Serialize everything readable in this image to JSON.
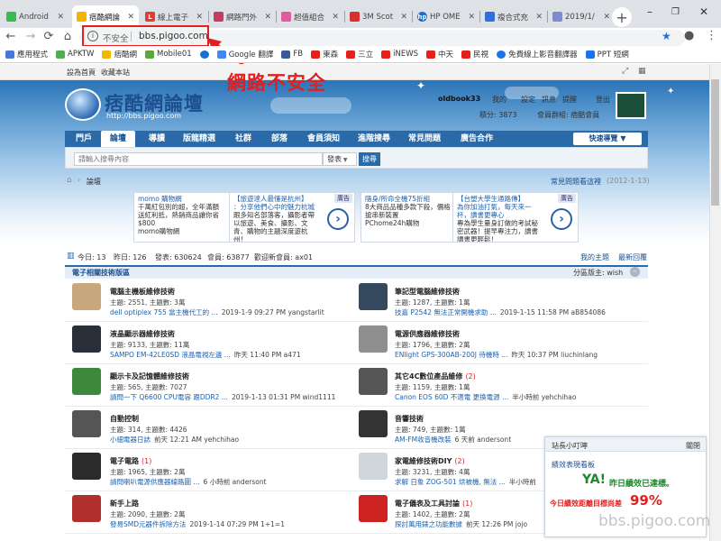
{
  "browser": {
    "tabs": [
      {
        "label": "Android",
        "fav_color": "#3dba4e"
      },
      {
        "label": "痞酷網論",
        "fav_color": "#f2b600"
      },
      {
        "label": "線上電子",
        "fav_color": "#e23d2d"
      },
      {
        "label": "網路門外",
        "fav_color": "#c53c63"
      },
      {
        "label": "超值組合",
        "fav_color": "#e05aa0"
      },
      {
        "label": "3M Scot",
        "fav_color": "#d83030"
      },
      {
        "label": "HP OME",
        "fav_color": "#1a6fd1"
      },
      {
        "label": "複合式充",
        "fav_color": "#2f6fd8"
      },
      {
        "label": "2019/1/",
        "fav_color": "#7d8bd6"
      }
    ],
    "new_tab_symbol": "+",
    "window_controls": [
      "–",
      "❐",
      "✕"
    ],
    "nav": {
      "back": "←",
      "forward": "→",
      "reload": "⟳",
      "home": "⌂"
    },
    "security_label": "不安全",
    "url": "bbs.pigoo.com",
    "info_symbol": "i",
    "star_symbol": "★",
    "account_symbol": "●",
    "menu_symbol": "⋮",
    "bookmarks": [
      {
        "label": "應用程式",
        "color": "#4a76d8"
      },
      {
        "label": "APKTW",
        "color": "#4caf50"
      },
      {
        "label": "痞酷網",
        "color": "#f2b600"
      },
      {
        "label": "Mobile01",
        "color": "#5aa83c"
      },
      {
        "label": "",
        "color": "#1a6fd1"
      },
      {
        "label": "Google 翻譯",
        "color": "#4285f4"
      },
      {
        "label": "FB",
        "color": "#3b5998"
      },
      {
        "label": "東森",
        "color": "#e62117"
      },
      {
        "label": "三立",
        "color": "#e62117"
      },
      {
        "label": "iNEWS",
        "color": "#e62117"
      },
      {
        "label": "中天",
        "color": "#e62117"
      },
      {
        "label": "民視",
        "color": "#e62117"
      },
      {
        "label": "免費線上影音翻譯器",
        "color": "#1a73e8"
      },
      {
        "label": "PPT 短網",
        "color": "#1a73e8"
      }
    ]
  },
  "annotation": {
    "text": "網路不安全",
    "color": "#e02020"
  },
  "site": {
    "topbar": {
      "links": [
        "設為首頁",
        "收藏本站"
      ]
    },
    "logo": {
      "title": "痞酷網論壇",
      "url": "http://bbs.pigoo.com"
    },
    "user": {
      "name": "oldbook33",
      "links": [
        "我的",
        "設定",
        "訊息",
        "提醒",
        "登出"
      ],
      "points_label": "積分: 3873",
      "group_label": "會員群組: 痞酷會員"
    },
    "nav": [
      "門戶",
      "論壇",
      "導讀",
      "版龍精選",
      "社群",
      "部落",
      "會員須知",
      "進階搜尋",
      "常見問題",
      "廣告合作"
    ],
    "quick_nav": "快速導覽 ▼",
    "search": {
      "placeholder": "請輸入搜尋內容",
      "type": "發表",
      "button": "搜尋"
    },
    "breadcrumb": {
      "home": "⌂",
      "sep": "›",
      "current": "論壇"
    },
    "notice": {
      "text": "常見問題看這裡",
      "date": "(2012-1-13)"
    },
    "ads": [
      {
        "tag": "廣告",
        "headline": "momo 購物網",
        "body": "千萬紅包別的超，全年滿額送紅利抵，熱銷商品讓你省$800",
        "foot": "momo購物網"
      },
      {
        "tag": "廣告",
        "headline": "【旅遊達人最懂是杭州】",
        "body": "：分享他們心中的魅力杭城",
        "foot": "跟多知名部落客，攝影者帶以旅遊、美食、攝影、文青、購物的主題深度遊杭州！"
      },
      {
        "tag": "廣告",
        "headline": "隨身/所命全機75折組",
        "body": "8大商品品種多款下殺，價格搶串新裝置",
        "foot": "PChome24h購物"
      },
      {
        "tag": "廣告",
        "headline": "【台塑大學生通路傳】",
        "body": "為你加油打氣，每天來一杯，讀書更專心",
        "foot": "專為學生量身訂做的考試秘密武器！提早專注力，讀書讀書更輕鬆！"
      }
    ],
    "stats": {
      "today_label": "今日: 13",
      "yesterday_label": "昨日: 126",
      "posts_label": "發表: 630624",
      "members_label": "會員: 63877",
      "welcome_label": "歡迎新會員: ax01",
      "links": [
        "我的主題",
        "最新回覆"
      ]
    },
    "section": {
      "title": "電子相關技術版區",
      "moderators": "分區版主: wish",
      "toggle": "–"
    },
    "categories": [
      {
        "name": "電腦主機板維修技術",
        "badge": "",
        "info": "主題: 2551, 主題數: 3萬",
        "last_link": "dell optiplex 755 當主機代工的 ...",
        "last_meta": "2019-1-9 09:27 PM yangstarlit",
        "icon": "#c9a77d"
      },
      {
        "name": "筆記型電腦維修技術",
        "badge": "",
        "info": "主題: 1287, 主題數: 1萬",
        "last_link": "技嘉 P2542 無法正常開機求助 ...",
        "last_meta": "2019-1-15 11:58 PM aB854086",
        "icon": "#34495e"
      },
      {
        "name": "液晶顯示器維修技術",
        "badge": "",
        "info": "主題: 9133, 主題數: 11萬",
        "last_link": "SAMPO EM-42LE0SD 液晶電視左邊 ...",
        "last_meta": "昨天 11:40 PM a471",
        "icon": "#2a2f3a"
      },
      {
        "name": "電源供應器維修技術",
        "badge": "",
        "info": "主題: 1796, 主題數: 2萬",
        "last_link": "ENlight GPS-300AB-200J 待機時 ...",
        "last_meta": "昨天 10:37 PM liuchinlang",
        "icon": "#8f8f8f"
      },
      {
        "name": "顯示卡及記憶體維修技術",
        "badge": "",
        "info": "主題: 565, 主題數: 7027",
        "last_link": "請問一下 Q6600 CPU電容 跟DDR2 ...",
        "last_meta": "2019-1-13 01:31 PM wind1111",
        "icon": "#3d8a3d"
      },
      {
        "name": "其它4C數位產品維修",
        "badge": "(2)",
        "info": "主題: 1159, 主題數: 1萬",
        "last_link": "Canon EOS 60D 不適電 更換電源 ...",
        "last_meta": "半小時前 yehchihao",
        "icon": "#555"
      },
      {
        "name": "自動控制",
        "badge": "",
        "info": "主題: 314, 主題數: 4426",
        "last_link": "小細電器日誌",
        "last_meta": "前天 12:21 AM yehchihao",
        "icon": "#555"
      },
      {
        "name": "音響技術",
        "badge": "",
        "info": "主題: 749, 主題數: 1萬",
        "last_link": "AM-FM收音機改裝",
        "last_meta": "6 天前 andersont",
        "icon": "#333"
      },
      {
        "name": "電子電路",
        "badge": "(1)",
        "info": "主題: 1965, 主題數: 2萬",
        "last_link": "請問喇叭電源供應器線路圖 ...",
        "last_meta": "6 小時前 andersont",
        "icon": "#2b2b2b"
      },
      {
        "name": "家電維修技術DIY",
        "badge": "(2)",
        "info": "主題: 3231, 主題數: 4萬",
        "last_link": "求解 日象 ZOG-501 烘被機, 無法 ...",
        "last_meta": "半小時前",
        "icon": "#cfd6dc"
      },
      {
        "name": "新手上路",
        "badge": "",
        "info": "主題: 2090, 主題數: 2萬",
        "last_link": "發易SMD元器件拆除方法",
        "last_meta": "2019-1-14 07:29 PM 1+1=1",
        "icon": "#b03030"
      },
      {
        "name": "電子儀表及工具討論",
        "badge": "(1)",
        "info": "主題: 1402, 主題數: 2萬",
        "last_link": "探討萬用錶之功能數據",
        "last_meta": "前天 12:26 PM jojo",
        "icon": "#cc2222"
      }
    ],
    "popup": {
      "title": "站長小叮嚀",
      "close": "關閉",
      "heading": "績效表現看板",
      "yes_label": "YA!",
      "yes_text": "昨日績效已達標。",
      "today_text": "今日績效距離目標尚差",
      "percent": "99%"
    },
    "watermark": "bbs.pigoo.com"
  }
}
